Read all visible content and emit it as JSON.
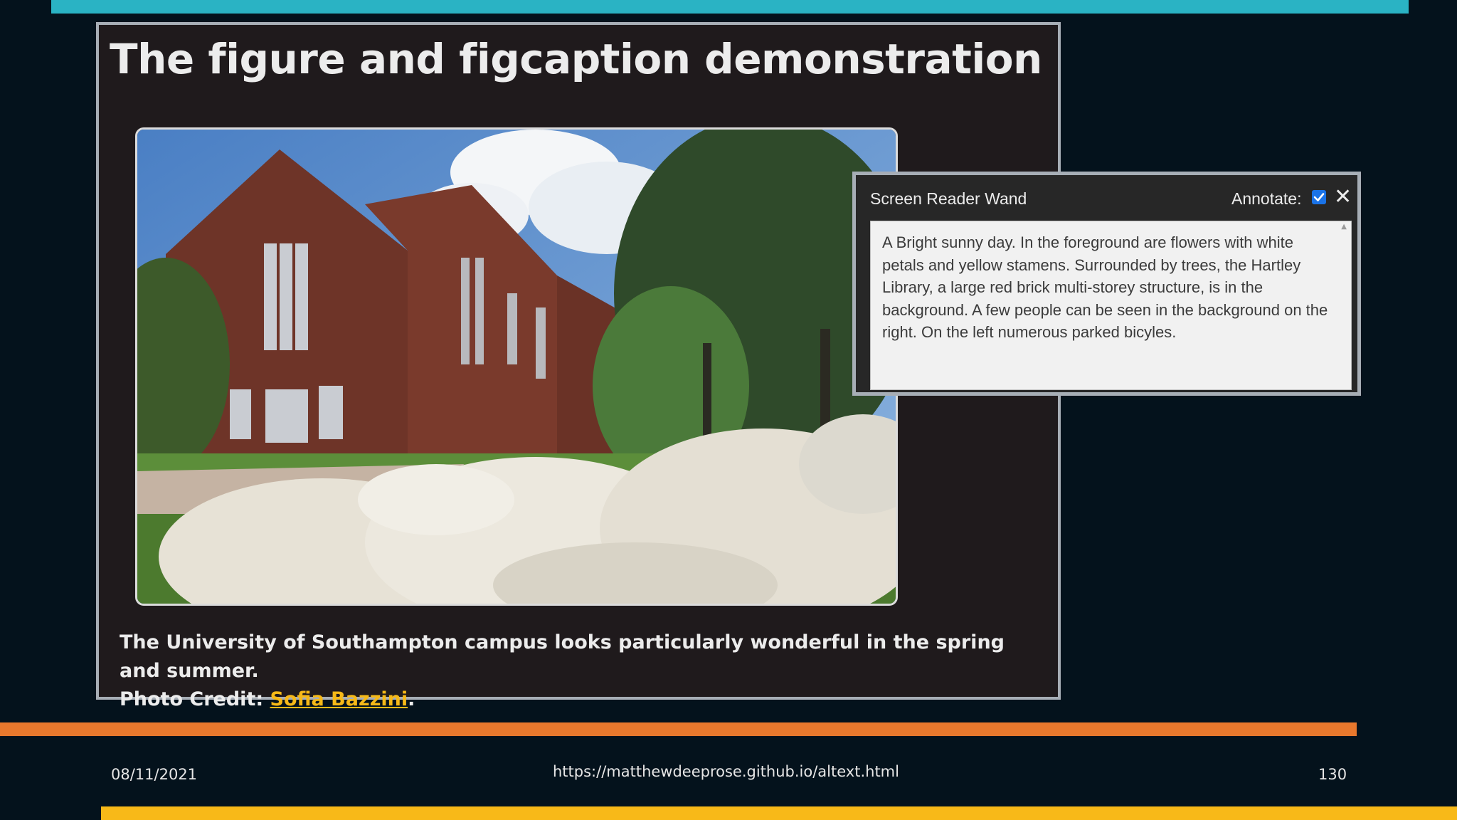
{
  "slide": {
    "title": "The figure and figcaption demonstration",
    "caption": {
      "text": "The University of Southampton campus looks particularly wonderful in the spring and summer.",
      "credit_prefix": "Photo Credit: ",
      "credit_link": "Sofia Bazzini",
      "credit_suffix": "."
    }
  },
  "wand": {
    "title": "Screen Reader Wand",
    "annotate_label": "Annotate:",
    "annotate_checked": true,
    "close_icon": "close-icon",
    "description": "A Bright sunny day. In the foreground are flowers with white petals and yellow stamens. Surrounded by trees, the Hartley Library, a large red brick multi-storey structure, is in the background. A few people can be seen in the background on the right. On the left numerous parked bicyles."
  },
  "footer": {
    "date": "08/11/2021",
    "url": "https://matthewdeeprose.github.io/altext.html",
    "page_number": "130"
  },
  "colors": {
    "page_background": "#04121c",
    "top_accent": "#2ab3c4",
    "orange_accent": "#e8782d",
    "yellow_accent": "#f8b918",
    "link": "#f6b918"
  }
}
